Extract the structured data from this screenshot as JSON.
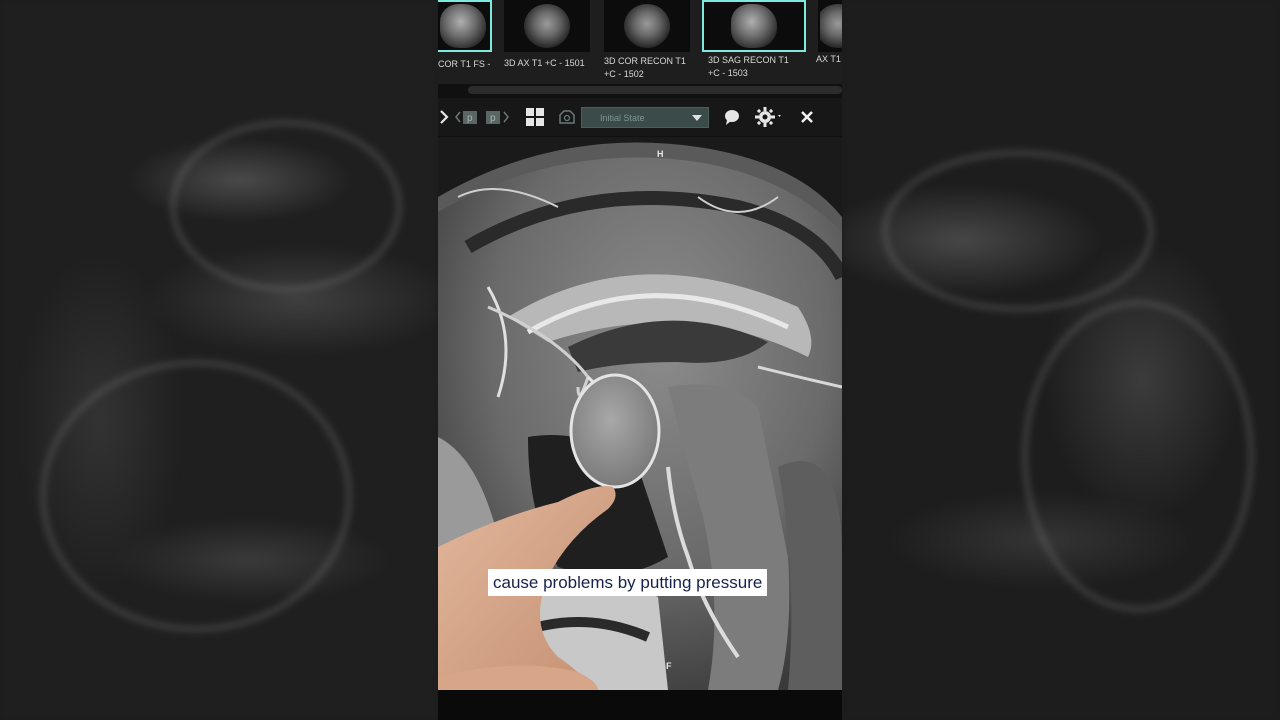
{
  "series_strip": {
    "items": [
      {
        "label_line1": "COR T1 FS -",
        "label_line2": "",
        "active": true
      },
      {
        "label_line1": "3D AX T1 +C - 1501",
        "label_line2": "",
        "active": false
      },
      {
        "label_line1": "3D COR RECON T1",
        "label_line2": "+C - 1502",
        "active": false
      },
      {
        "label_line1": "3D SAG RECON T1",
        "label_line2": "+C - 1503",
        "active": true
      },
      {
        "label_line1": "AX T1",
        "label_line2": "",
        "active": false
      }
    ]
  },
  "toolbar": {
    "state_select_value": "Initial State",
    "icons": [
      "chevron-right-icon",
      "prev-page-icon",
      "next-page-icon",
      "layout-grid-icon",
      "camera-icon",
      "comment-icon",
      "gear-icon",
      "close-icon"
    ]
  },
  "viewer": {
    "orientation_top": "H",
    "orientation_bottom": "F"
  },
  "caption": {
    "text": "cause problems by putting pressure"
  },
  "colors": {
    "active_thumb_border": "#7fe8df",
    "caption_text": "#16224a",
    "caption_bg": "#ffffff"
  }
}
